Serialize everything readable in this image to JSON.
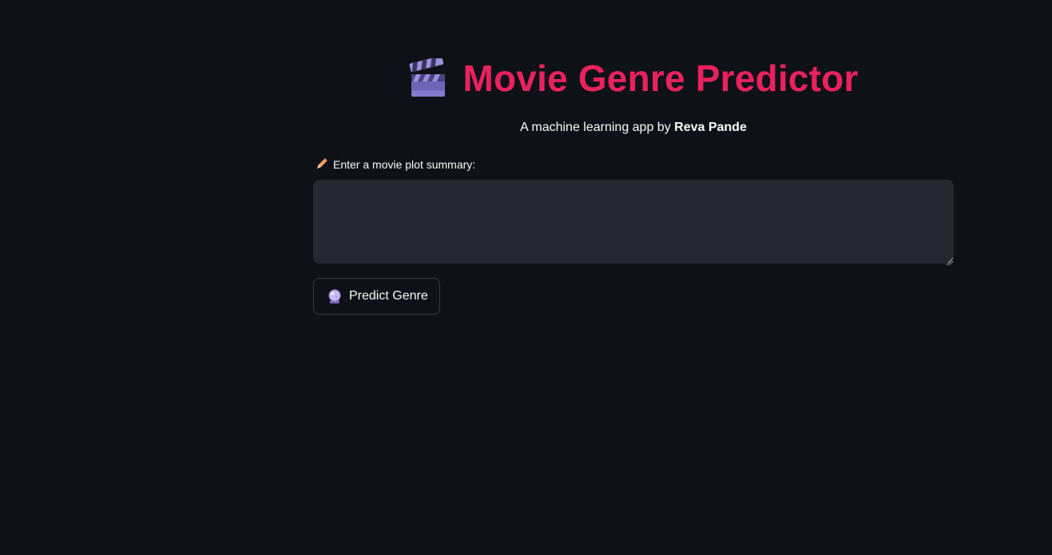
{
  "header": {
    "title": "Movie Genre Predictor",
    "title_icon": "clapperboard-icon",
    "title_color": "#e8225e"
  },
  "subtitle": {
    "prefix": "A machine learning app by ",
    "author": "Reva Pande"
  },
  "plot_input": {
    "label": "Enter a movie plot summary:",
    "label_icon": "pencil-icon",
    "value": "",
    "placeholder": ""
  },
  "predict_button": {
    "label": "Predict Genre",
    "icon": "crystal-ball-icon"
  },
  "colors": {
    "background": "#0e1117",
    "input_background": "#262730",
    "accent": "#e8225e"
  }
}
